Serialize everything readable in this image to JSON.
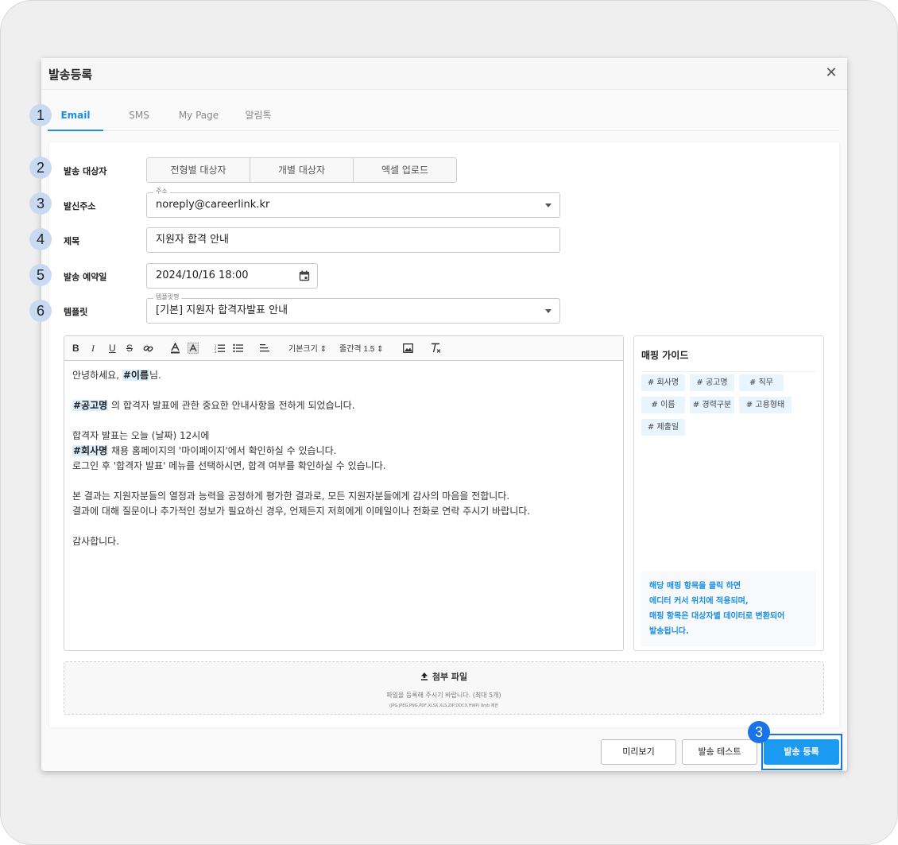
{
  "dialog": {
    "title": "발송등록",
    "close_glyph": "✕"
  },
  "tabs": [
    "Email",
    "SMS",
    "My Page",
    "알림톡"
  ],
  "active_tab": "Email",
  "form": {
    "target": {
      "label": "발송 대상자",
      "options": [
        "전형별 대상자",
        "개별 대상자",
        "엑셀 업로드"
      ]
    },
    "sender": {
      "label": "발신주소",
      "legend": "주소",
      "value": "noreply@careerlink.kr"
    },
    "subject": {
      "label": "제목",
      "value": "지원자 합격 안내"
    },
    "schedule": {
      "label": "발송 예약일",
      "value": "2024/10/16 18:00"
    },
    "template": {
      "label": "템플릿",
      "legend": "템플릿명",
      "value": "[기본] 지원자 합격자발표 안내"
    }
  },
  "toolbar": {
    "font_size": "기본크기",
    "line_height": "줄간격 1.5"
  },
  "editor": {
    "greeting_pre": "안녕하세요,",
    "greeting_tag": "#이름",
    "greeting_post": "님.",
    "p2_tag": "#공고명",
    "p2_text": "의 합격자 발표에 관한 중요한 안내사항을 전하게 되었습니다.",
    "p3_line1": "합격자 발표는 오늘 (날짜) 12시에",
    "p3_tag": "#회사명",
    "p3_line2": "채용 홈페이지의 '마이페이지'에서 확인하실 수 있습니다.",
    "p3_line3": "로그인 후 '합격자 발표' 메뉴를 선택하시면, 합격 여부를 확인하실 수 있습니다.",
    "p4_line1": "본 결과는 지원자분들의 열정과 능력을 공정하게 평가한 결과로, 모든 지원자분들에게 감사의 마음을 전합니다.",
    "p4_line2": "결과에 대해 질문이나 추가적인 정보가 필요하신 경우, 언제든지 저희에게 이메일이나 전화로 연락 주시기 바랍니다.",
    "closing": "감사합니다."
  },
  "guide": {
    "title": "매핑 가이드",
    "chips": [
      "# 회사명",
      "# 공고명",
      "# 직무",
      "# 이름",
      "# 경력구분",
      "# 고용형태",
      "# 제출일"
    ],
    "note": [
      "해당 매핑 항목을 클릭 하면",
      "에디터 커서 위치에 적용되며,",
      "매핑 항목은 대상자별 데이터로 변환되어",
      "발송됩니다."
    ]
  },
  "attach": {
    "title": "첨부 파일",
    "desc": "파일을 등록해 주시기 바랍니다. (최대 5개)",
    "types": "(JPG,JPEG,PNG,PDF,XLSX,XLS,ZIP,DOCX,HWP) 8mb 제한"
  },
  "footer": {
    "preview": "미리보기",
    "test": "발송 테스트",
    "submit": "발송 등록"
  },
  "markers": [
    "1",
    "2",
    "3",
    "4",
    "5",
    "6",
    "3"
  ],
  "colors": {
    "accent": "#1a8fe3",
    "primary_button": "#1a9af0",
    "tag_highlight": "#dcefff",
    "marker": "#c8daf1",
    "marker_blue": "#1a73e8"
  }
}
